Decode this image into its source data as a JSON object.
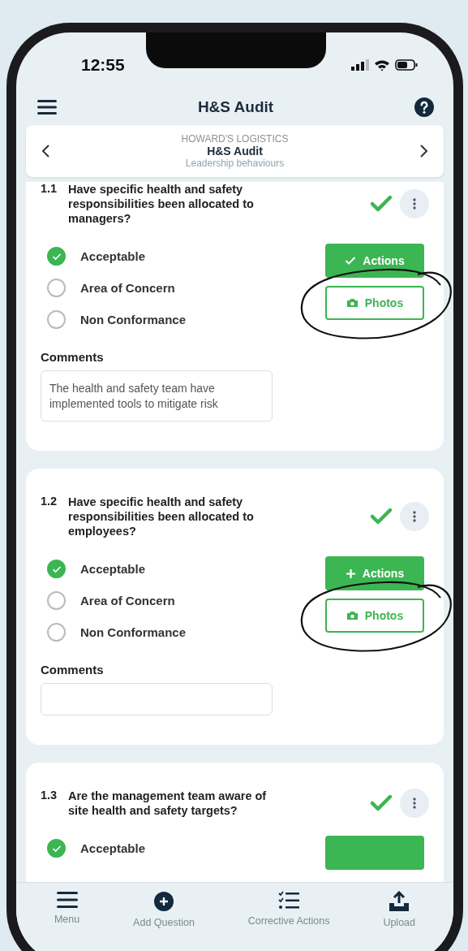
{
  "status_bar": {
    "time": "12:55"
  },
  "header": {
    "title": "H&S Audit"
  },
  "audit_card": {
    "company": "HOWARD'S LOGISTICS",
    "title": "H&S Audit",
    "section": "Leadership behaviours"
  },
  "questions": [
    {
      "number": "1.1",
      "text": "Have specific health and safety responsibilities been allocated to managers?",
      "answered": true,
      "annotated": true,
      "options": [
        {
          "label": "Acceptable",
          "selected": true
        },
        {
          "label": "Area of Concern",
          "selected": false
        },
        {
          "label": "Non Conformance",
          "selected": false
        }
      ],
      "actions": {
        "label": "Actions",
        "kind": "check"
      },
      "photos_label": "Photos",
      "comments_label": "Comments",
      "comment": "The health and safety team have implemented tools to mitigate risk"
    },
    {
      "number": "1.2",
      "text": "Have specific health and safety responsibilities been allocated to employees?",
      "answered": true,
      "annotated": true,
      "options": [
        {
          "label": "Acceptable",
          "selected": true
        },
        {
          "label": "Area of Concern",
          "selected": false
        },
        {
          "label": "Non Conformance",
          "selected": false
        }
      ],
      "actions": {
        "label": "Actions",
        "kind": "plus"
      },
      "photos_label": "Photos",
      "comments_label": "Comments"
    },
    {
      "number": "1.3",
      "text": "Are the management team aware of site health and safety targets?",
      "answered": true,
      "annotated": false,
      "options": [
        {
          "label": "Acceptable",
          "selected": true
        }
      ],
      "actions": {
        "kind": "plain"
      }
    }
  ],
  "bottom_nav": [
    {
      "label": "Menu",
      "kind": "menu"
    },
    {
      "label": "Add Question",
      "kind": "add"
    },
    {
      "label": "Corrective Actions",
      "kind": "checklist"
    },
    {
      "label": "Upload",
      "kind": "upload"
    }
  ]
}
